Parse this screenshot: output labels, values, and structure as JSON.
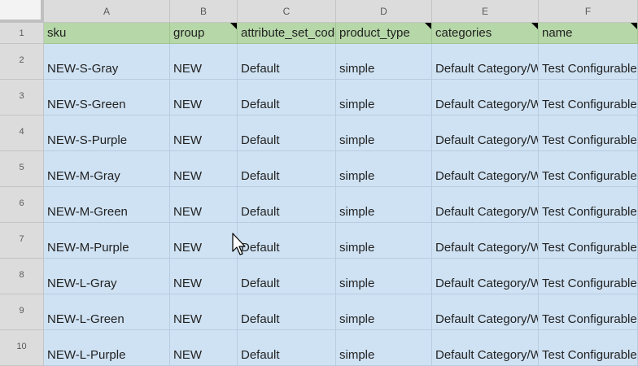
{
  "columns": [
    "A",
    "B",
    "C",
    "D",
    "E",
    "F"
  ],
  "rows": [
    "1",
    "2",
    "3",
    "4",
    "5",
    "6",
    "7",
    "8",
    "9",
    "10"
  ],
  "header_cells": [
    "sku",
    "group",
    "attribute_set_code",
    "product_type",
    "categories",
    "name"
  ],
  "data_rows": [
    [
      "NEW-S-Gray",
      "NEW",
      "Default",
      "simple",
      "Default Category/Women",
      "Test Configurable"
    ],
    [
      "NEW-S-Green",
      "NEW",
      "Default",
      "simple",
      "Default Category/Women",
      "Test Configurable"
    ],
    [
      "NEW-S-Purple",
      "NEW",
      "Default",
      "simple",
      "Default Category/Women",
      "Test Configurable"
    ],
    [
      "NEW-M-Gray",
      "NEW",
      "Default",
      "simple",
      "Default Category/Women",
      "Test Configurable"
    ],
    [
      "NEW-M-Green",
      "NEW",
      "Default",
      "simple",
      "Default Category/Women",
      "Test Configurable"
    ],
    [
      "NEW-M-Purple",
      "NEW",
      "Default",
      "simple",
      "Default Category/Women",
      "Test Configurable"
    ],
    [
      "NEW-L-Gray",
      "NEW",
      "Default",
      "simple",
      "Default Category/Women",
      "Test Configurable"
    ],
    [
      "NEW-L-Green",
      "NEW",
      "Default",
      "simple",
      "Default Category/Women",
      "Test Configurable"
    ],
    [
      "NEW-L-Purple",
      "NEW",
      "Default",
      "simple",
      "Default Category/Women",
      "Test Configurable"
    ]
  ],
  "colors": {
    "header_fill": "#b6d7a8",
    "selection_fill": "#cfe2f3",
    "chrome_fill": "#dcdcdc"
  },
  "icons": {
    "cursor": "mouse-pointer-icon",
    "note": "comment-indicator-icon"
  }
}
